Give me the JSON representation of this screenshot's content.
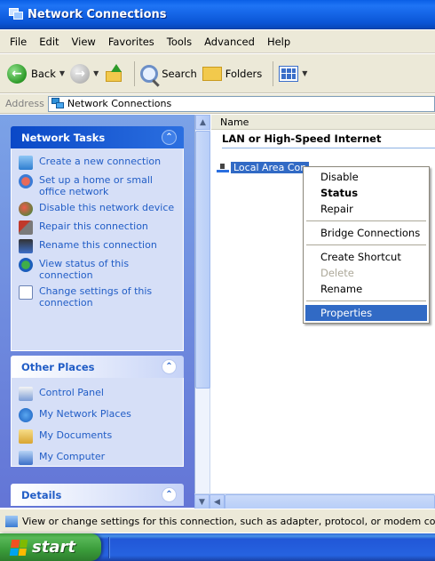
{
  "window": {
    "title": "Network Connections"
  },
  "menu": [
    "File",
    "Edit",
    "View",
    "Favorites",
    "Tools",
    "Advanced",
    "Help"
  ],
  "toolbar": {
    "back_label": "Back",
    "search_label": "Search",
    "folders_label": "Folders"
  },
  "address": {
    "label": "Address",
    "value": "Network Connections"
  },
  "network_tasks": {
    "title": "Network Tasks",
    "items": [
      {
        "label": "Create a new connection",
        "icon": "new-connection-icon"
      },
      {
        "label": "Set up a home or small office network",
        "icon": "home-network-icon"
      },
      {
        "label": "Disable this network device",
        "icon": "disable-device-icon"
      },
      {
        "label": "Repair this connection",
        "icon": "repair-icon"
      },
      {
        "label": "Rename this connection",
        "icon": "rename-icon"
      },
      {
        "label": "View status of this connection",
        "icon": "status-icon"
      },
      {
        "label": "Change settings of this connection",
        "icon": "settings-icon"
      }
    ]
  },
  "other_places": {
    "title": "Other Places",
    "items": [
      {
        "label": "Control Panel",
        "icon": "control-panel-icon"
      },
      {
        "label": "My Network Places",
        "icon": "network-places-icon"
      },
      {
        "label": "My Documents",
        "icon": "my-documents-icon"
      },
      {
        "label": "My Computer",
        "icon": "my-computer-icon"
      }
    ]
  },
  "details": {
    "title": "Details"
  },
  "list": {
    "column_name": "Name",
    "group": "LAN or High-Speed Internet",
    "selected_item": "Local Area Con"
  },
  "context_menu": {
    "disable": "Disable",
    "status": "Status",
    "repair": "Repair",
    "bridge": "Bridge Connections",
    "shortcut": "Create Shortcut",
    "delete": "Delete",
    "rename": "Rename",
    "properties": "Properties"
  },
  "status_bar": {
    "text": "View or change settings for this connection, such as adapter, protocol, or modem configu"
  },
  "taskbar": {
    "start_label": "start"
  },
  "colors": {
    "title_blue": "#0a5fe6",
    "selection_blue": "#316ac5",
    "task_link": "#215dc6",
    "start_green": "#3a9c3a"
  }
}
